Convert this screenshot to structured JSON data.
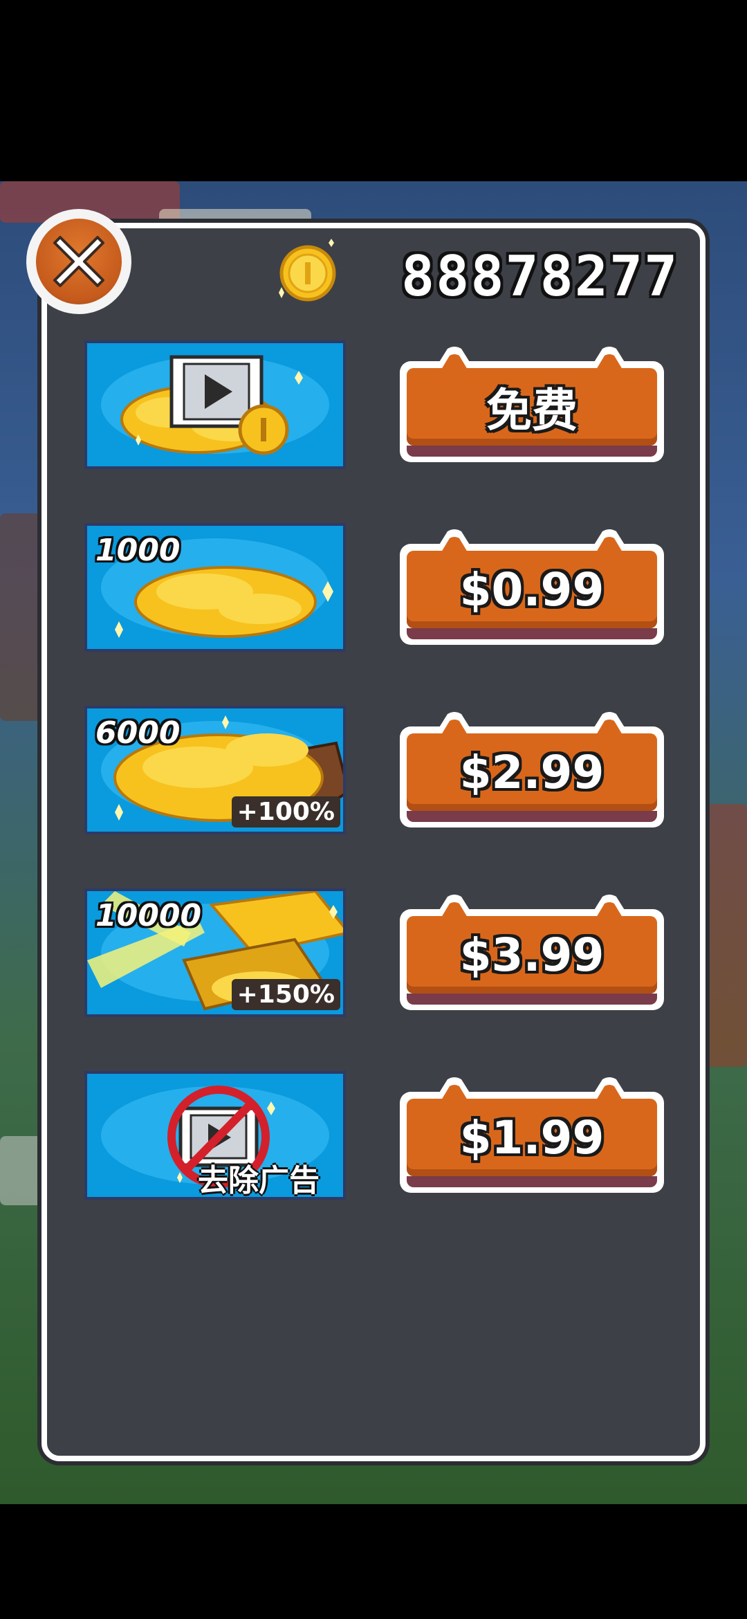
{
  "header": {
    "balance": "88878277",
    "coin_icon": "gold-coin-icon",
    "close_icon": "close-icon"
  },
  "shop": {
    "items": [
      {
        "tile_icon": "video-coins-icon",
        "amount": "",
        "bonus": "",
        "caption": "",
        "price": "免费"
      },
      {
        "tile_icon": "coin-pile-icon",
        "amount": "1000",
        "bonus": "",
        "caption": "",
        "price": "$0.99"
      },
      {
        "tile_icon": "coin-chest-icon",
        "amount": "6000",
        "bonus": "+100%",
        "caption": "",
        "price": "$2.99"
      },
      {
        "tile_icon": "gold-bars-icon",
        "amount": "10000",
        "bonus": "+150%",
        "caption": "",
        "price": "$3.99"
      },
      {
        "tile_icon": "no-ads-icon",
        "amount": "",
        "bonus": "",
        "caption": "去除广告",
        "price": "$1.99"
      }
    ]
  },
  "colors": {
    "panel_bg": "#3d4047",
    "tile_bg": "#0a9ade",
    "button_orange": "#d9671b",
    "gold": "#f7c21e"
  }
}
